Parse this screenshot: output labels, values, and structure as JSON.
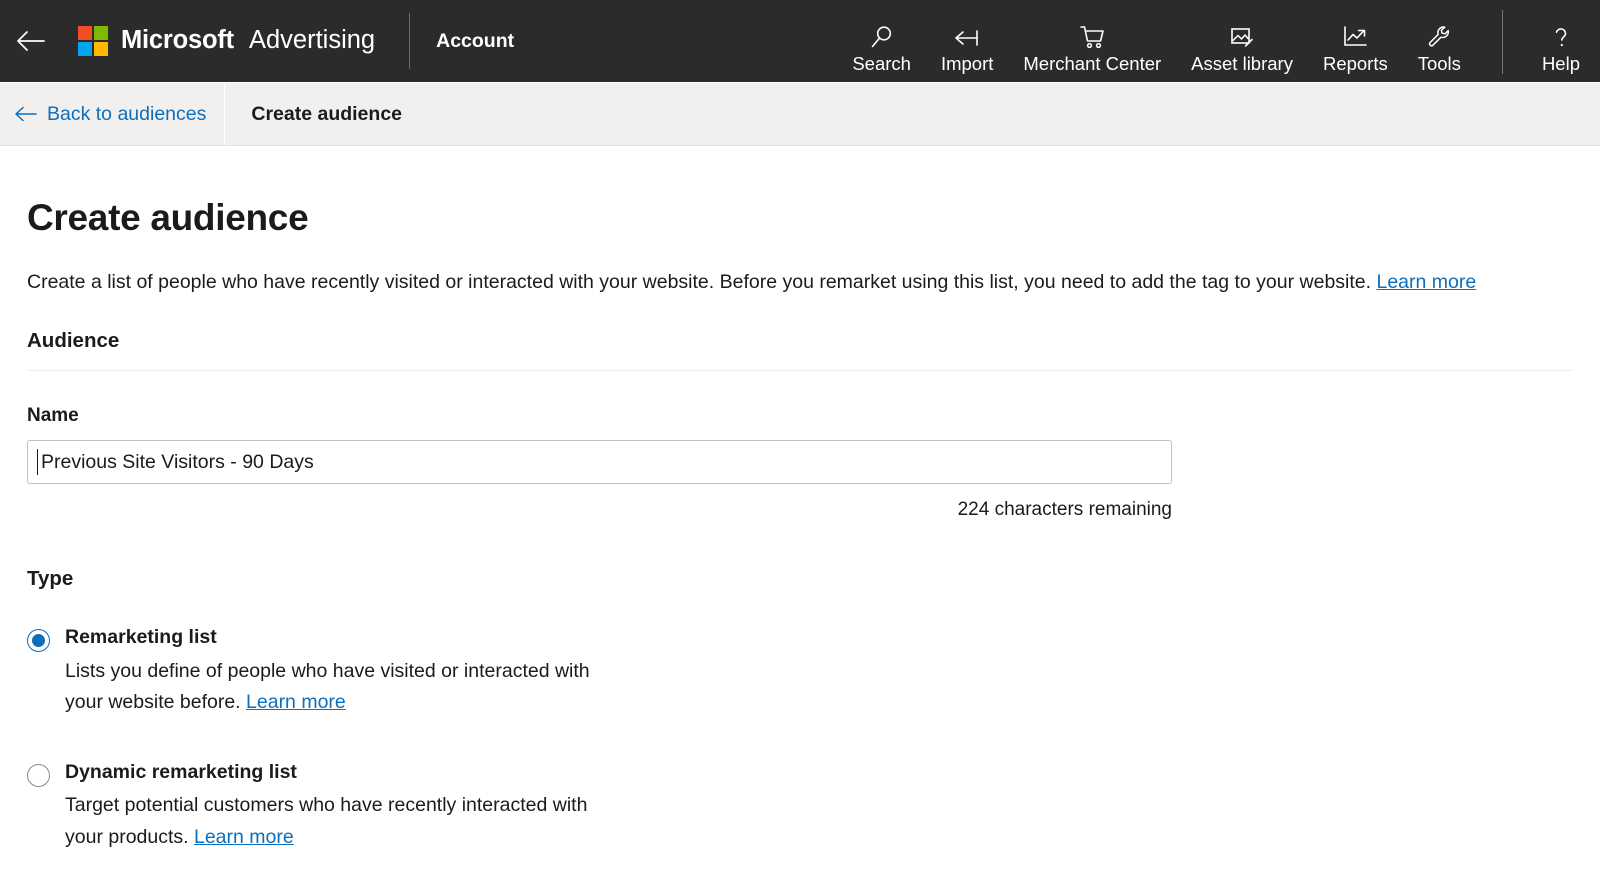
{
  "header": {
    "back_icon": "arrow-left-icon",
    "brand_microsoft": "Microsoft",
    "brand_product": "Advertising",
    "account_label": "Account",
    "nav_items": [
      {
        "label": "Search",
        "icon": "search-icon"
      },
      {
        "label": "Import",
        "icon": "import-arrow-icon"
      },
      {
        "label": "Merchant Center",
        "icon": "shopping-cart-icon"
      },
      {
        "label": "Asset library",
        "icon": "image-edit-icon"
      },
      {
        "label": "Reports",
        "icon": "line-chart-icon"
      },
      {
        "label": "Tools",
        "icon": "wrench-icon"
      },
      {
        "label": "Help",
        "icon": "question-mark-icon"
      }
    ]
  },
  "breadcrumb": {
    "back_label": "Back to audiences",
    "back_icon": "arrow-left-icon",
    "current": "Create audience"
  },
  "page": {
    "title": "Create audience",
    "description_before": "Create a list of people who have recently visited or interacted with your website. Before you remarket using this list, you need to add the tag to your website.",
    "description_link": "Learn more"
  },
  "audience_section": {
    "title": "Audience",
    "name_label": "Name",
    "name_value": "Previous Site Visitors - 90 Days",
    "name_placeholder": "",
    "characters_remaining": "224 characters remaining"
  },
  "type_section": {
    "title": "Type",
    "options": [
      {
        "label": "Remarketing list",
        "description": "Lists you define of people who have visited or interacted with your website before.",
        "link": "Learn more",
        "selected": true
      },
      {
        "label": "Dynamic remarketing list",
        "description": "Target potential customers who have recently interacted with your products.",
        "link": "Learn more",
        "selected": false
      }
    ]
  },
  "colors": {
    "header_bg": "#2B2B2B",
    "breadcrumb_bg": "#F2F0EF",
    "link_blue": "#0D6EBB",
    "accent_radio": "#0D6EBB",
    "text_primary": "#1B1B1B",
    "logo_red": "#F25022",
    "logo_green": "#7FBA00",
    "logo_blue": "#00A4EF",
    "logo_yellow": "#FFB900",
    "input_border": "#B4C4C4"
  }
}
